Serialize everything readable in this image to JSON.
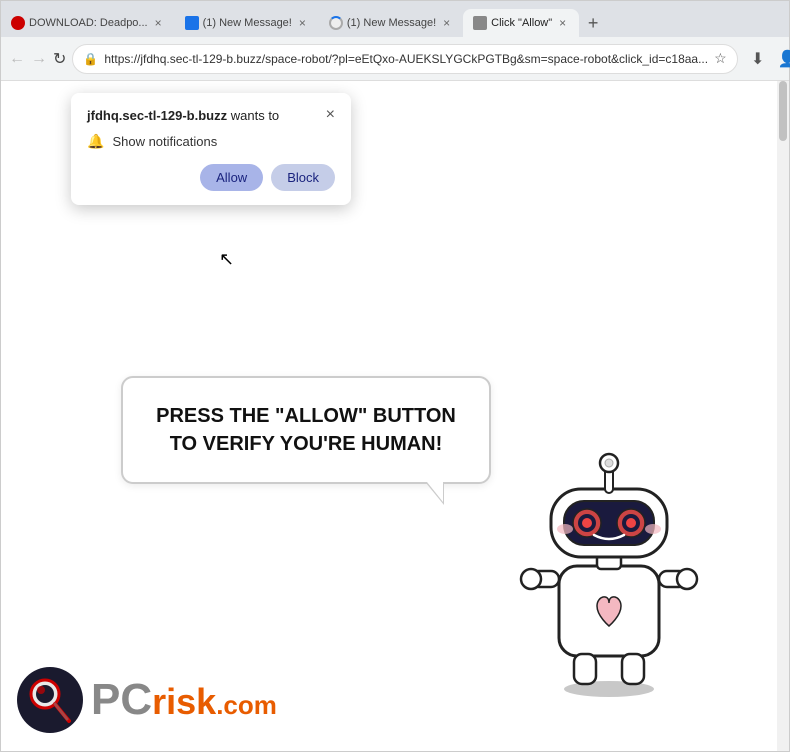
{
  "browser": {
    "tabs": [
      {
        "id": "tab1",
        "title": "DOWNLOAD: Deadpo...",
        "favicon": "red",
        "active": false
      },
      {
        "id": "tab2",
        "title": "(1) New Message!",
        "favicon": "blue",
        "active": false
      },
      {
        "id": "tab3",
        "title": "(1) New Message!",
        "favicon": "spin",
        "active": false
      },
      {
        "id": "tab4",
        "title": "Click \"Allow\"",
        "favicon": "click",
        "active": true
      }
    ],
    "new_tab_label": "+",
    "nav": {
      "back": "←",
      "forward": "→",
      "reload": "↻"
    },
    "address": "https://jfdhq.sec-tl-129-b.buzz/space-robot/?pl=eEtQxo-AUEKSLYGCkPGTBg&sm=space-robot&click_id=c18aa...",
    "toolbar": {
      "bookmark": "☆",
      "download": "⬇",
      "profile": "👤",
      "menu": "⋮"
    }
  },
  "notification_popup": {
    "site": "jfdhq.sec-tl-129-b.buzz",
    "wants_to": "wants to",
    "close_icon": "×",
    "permission_text": "Show notifications",
    "allow_label": "Allow",
    "block_label": "Block"
  },
  "page": {
    "speech_bubble_text": "PRESS THE \"ALLOW\" BUTTON TO VERIFY YOU'RE HUMAN!"
  },
  "pcrisk": {
    "pc": "PC",
    "risk": "risk",
    "dotcom": ".com"
  }
}
